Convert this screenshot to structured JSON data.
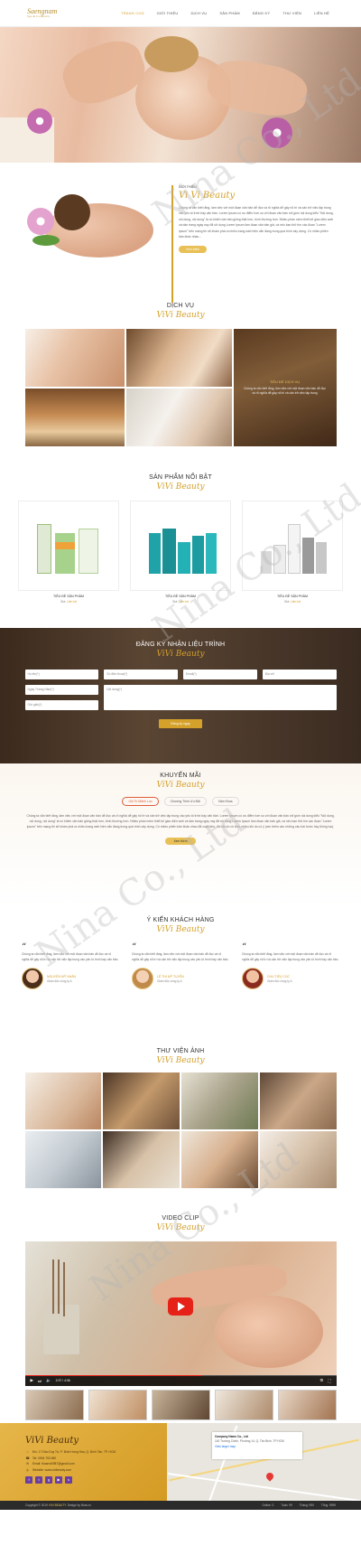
{
  "brand": {
    "logo_main": "Saengnam",
    "logo_sub": "Spa & Cosmetics"
  },
  "nav": {
    "items": [
      "Trang chủ",
      "Giới thiệu",
      "Dịch vụ",
      "Sản phẩm",
      "Đăng ký",
      "Thư viện",
      "Liên hệ"
    ],
    "active_index": 0
  },
  "about": {
    "eyebrow": "Giới thiệu",
    "script": "Vi Vi Beauty",
    "text": "Chúng ta vẫn biết rằng, làm việc với một đoạn văn bản dễ đọc và rõ nghĩa dễ gây rối trí và cản trở việc tập trung vào yếu tố trình bày văn bản. Lorem Ipsum có ưu điểm hơn so với đoạn văn bản chỉ gồm nội dung kiểu \"Nội dung, nội dung, nội dung\" là nó khiến văn bản giống thật hơn, bình thường hơn. Nhiều phần mềm thiết kế giao diện web và dàn trang ngày nay đã sử dụng Lorem Ipsum làm đoạn văn bản giả, và nếu bạn thử tìm các đoạn \"Lorem ipsum\" trên mạng thì sẽ khám phá ra nhiều trang web hiện vẫn đang trong quá trình xây dựng. Có nhiều phiên bản khác nhau...",
    "button": "Xem thêm"
  },
  "services": {
    "title": "DỊCH VỤ",
    "script": "ViVi Beauty",
    "featured_title": "Tiêu đề dịch vụ",
    "featured_text": "Chúng ta vẫn biết rằng, làm việc với một đoạn văn bản dễ đọc và rõ nghĩa dễ gây rối trí và cản trở việc tập trung"
  },
  "products": {
    "title": "SẢN PHẨM NỔI BẬT",
    "script": "ViVi Beauty",
    "items": [
      {
        "name": "Tiêu đề sản phẩm",
        "price_label": "Giá:",
        "price": "Liên hệ"
      },
      {
        "name": "Tiêu đề sản phẩm",
        "price_label": "Giá:",
        "price": "Liên hệ"
      },
      {
        "name": "Tiêu đề sản phẩm",
        "price_label": "Giá:",
        "price": "Liên hệ"
      }
    ]
  },
  "register": {
    "title": "ĐĂNG KÝ NHẬN LIỆU TRÌNH",
    "script": "ViVi Beauty",
    "fields": {
      "name": "Họ tên(*)",
      "phone": "Số điện thoại(*)",
      "email": "Email(*)",
      "address": "Địa chỉ",
      "date": "Ngày Tháng Năm(*)",
      "time": "Giờ giấc(*)",
      "message": "Nội dung(*)"
    },
    "button": "Đăng ký ngay"
  },
  "promos": {
    "title": "KHUYẾN MÃI",
    "script": "ViVi Beauty",
    "tabs": [
      "Gội Trị Mãnh Lực",
      "Chương Trình Ưu Đãi",
      "Xăm Khoa"
    ],
    "active_tab": 0,
    "text": "Chúng ta vẫn biết rằng, làm việc với một đoạn văn bản dễ đọc và rõ nghĩa dễ gây rối trí và cản trở việc tập trung vào yếu tố trình bày văn bản. Lorem Ipsum có ưu điểm hơn so với đoạn văn bản chỉ gồm nội dung kiểu \"Nội dung, nội dung, nội dung\" là nó khiến văn bản giống thật hơn, bình thường hơn. Nhiều phần mềm thiết kế giao diện web và dàn trang ngày nay đã sử dụng Lorem Ipsum làm đoạn văn bản giả, và nếu bạn thử tìm các đoạn \"Lorem ipsum\" trên mạng thì sẽ khám phá ra nhiều trang web hiện vẫn đang trong quá trình xây dựng. Có nhiều phiên bản khác nhau đã xuất hiện, đôi khi do vô tình, nhiều khi do cố ý (xen thêm vào những câu hài hước hay thông tục).",
    "button": "Xem thêm"
  },
  "testimonials": {
    "title": "Ý KIẾN KHÁCH HÀNG",
    "script": "ViVi Beauty",
    "items": [
      {
        "text": "Chúng ta vẫn biết rằng, làm việc với một đoạn văn bản dễ đọc và rõ nghĩa dễ gây rối trí và cản trở việc tập trung vào yếu tố trình bày văn bản.",
        "name": "Nguyễn Mỹ Nhân",
        "role": "Giám đốc công ty A"
      },
      {
        "text": "Chúng ta vẫn biết rằng, làm việc với một đoạn văn bản dễ đọc và rõ nghĩa dễ gây rối trí và cản trở việc tập trung vào yếu tố trình bày văn bản.",
        "name": "Lê Thị Mỹ Tuyền",
        "role": "Giám đốc công ty A"
      },
      {
        "text": "Chúng ta vẫn biết rằng, làm việc với một đoạn văn bản dễ đọc và rõ nghĩa dễ gây rối trí và cản trở việc tập trung vào yếu tố trình bày văn bản.",
        "name": "Chu Tiểu Cúc",
        "role": "Giám đốc công ty A"
      }
    ]
  },
  "gallery": {
    "title": "THƯ VIỆN ẢNH",
    "script": "ViVi Beauty"
  },
  "video": {
    "title": "VIDEO CLIP",
    "script": "ViVi Beauty",
    "time": "2:37 / 4:36",
    "progress": 0.57
  },
  "footer": {
    "logo": "ViVi Beauty",
    "address": "Đ/c: 17 Đào Duy Từ, P. Bình Hưng Hòa, Q. Bình Tân, TP. HCM",
    "phone": "Tel: 0904 753 650",
    "email": "Email: thuanvt0987@gmail.com",
    "website": "Website: www.vivibeauty.com",
    "map_name": "Company Name Co., Ltd",
    "map_address": "140 Trường Chinh, Phường 14, Q. Tân Bình, TP HCM",
    "map_link": "View larger map",
    "copyright": "Copyright © 2019 ",
    "copyright_brand": "VIVI BEAUTY",
    "designer": ". Design by Nina.vn",
    "stats": {
      "online": "Online: 3",
      "week": "Tuần: 99",
      "month": "Tháng: 990",
      "total": "Tổng: 9999"
    }
  },
  "watermark": "Nina Co., Ltd",
  "colors": {
    "accent": "#d4a12a",
    "dark": "#3b2a1d",
    "footer_gold": "#e6b64a"
  }
}
